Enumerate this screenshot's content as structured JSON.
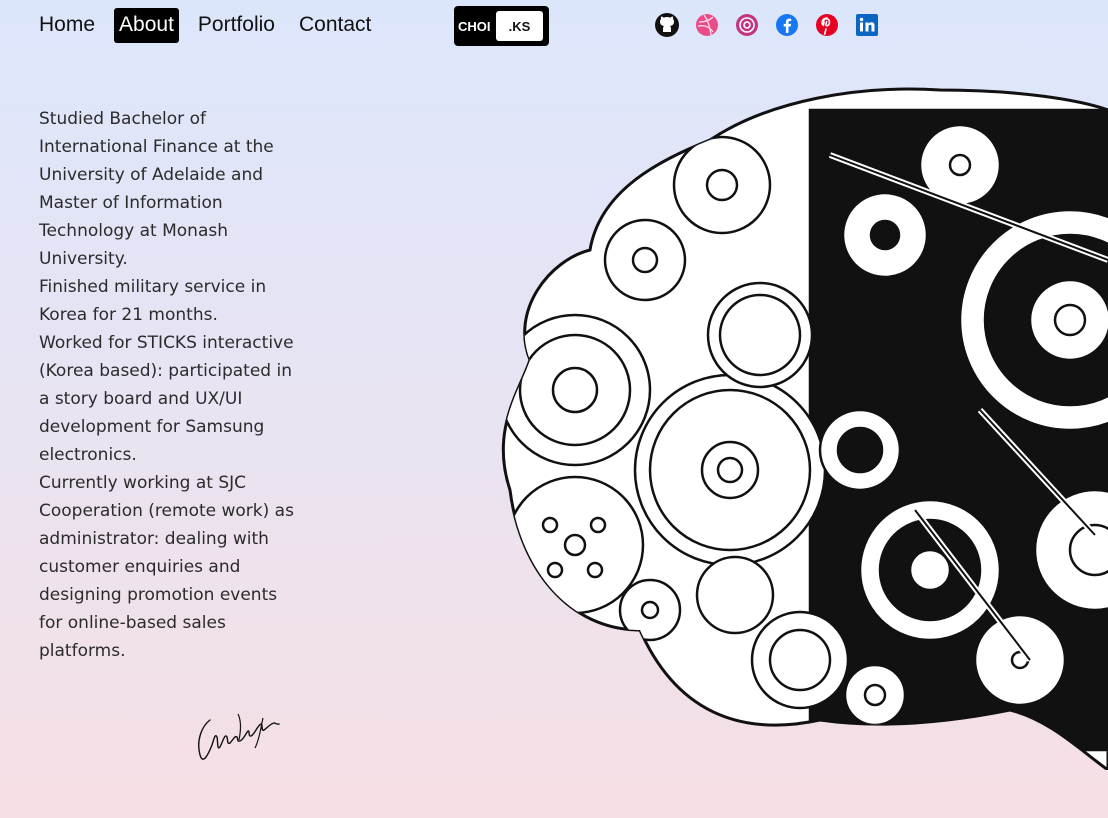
{
  "nav": {
    "items": [
      {
        "label": "Home",
        "active": false
      },
      {
        "label": "About",
        "active": true
      },
      {
        "label": "Portfolio",
        "active": false
      },
      {
        "label": "Contact",
        "active": false
      }
    ]
  },
  "logo": {
    "left": "CHOI",
    "right": ".KS"
  },
  "social": [
    "github-icon",
    "dribbble-icon",
    "instagram-icon",
    "facebook-icon",
    "pinterest-icon",
    "linkedin-icon"
  ],
  "about": {
    "paragraphs": [
      "Studied Bachelor of International Finance at the University of Adelaide and Master of Information Technology at Monash University.",
      "Finished military service in Korea for 21 months.",
      "Worked for STICKS interactive (Korea based): participated in a story board and UX/UI development for Samsung electronics.",
      "Currently working at SJC Cooperation (remote work) as administrator: dealing with customer enquiries and designing promotion events for online-based sales platforms."
    ]
  },
  "colors": {
    "accent": "#000000",
    "dribbble": "#ea4c89",
    "instagram": "#c13584",
    "facebook": "#1877f2",
    "pinterest": "#e60023",
    "linkedin": "#0a66c2"
  }
}
